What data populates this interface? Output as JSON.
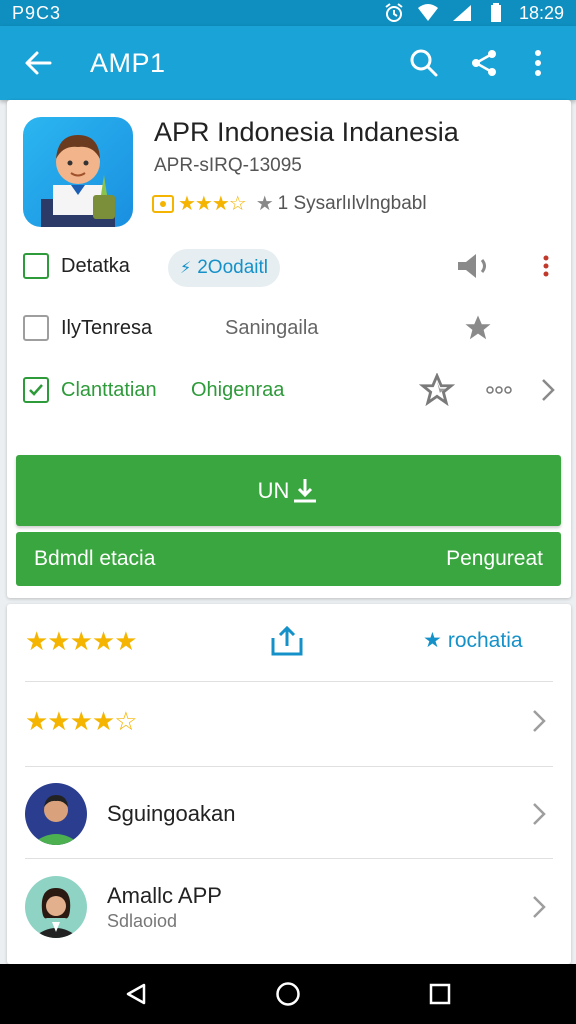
{
  "status_bar": {
    "left_text": "P9C3",
    "time": "18:29"
  },
  "app_bar": {
    "title": "AMP1"
  },
  "app": {
    "name": "APR Indonesia Indanesia",
    "id": "APR-sIRQ-13095",
    "rating_text": "1 Sysarlılvlngbabl"
  },
  "rows": [
    {
      "label": "Detatka",
      "chip": "2Oodaitl",
      "checked": false
    },
    {
      "label": "IlyTenresa",
      "middle": "Saningaila",
      "checked": false
    },
    {
      "label": "Clanttatian",
      "middle": "Ohigenraa",
      "checked": true
    }
  ],
  "install_button": {
    "label": "UN"
  },
  "secondary_bar": {
    "left": "Bdmdl etacia",
    "right": "Pengureat"
  },
  "reviews": {
    "rating_5": "★★★★★",
    "rating_4": "★★★★☆",
    "share_label": "rochatia"
  },
  "people": [
    {
      "name": "Sguingoakan",
      "subtitle": ""
    },
    {
      "name": "Amallc APP",
      "subtitle": "Sdlaoiod"
    }
  ],
  "colors": {
    "appbar": "#1aa3d6",
    "statusbar": "#0e8fbf",
    "green": "#3aa63f",
    "star": "#f4b400"
  }
}
